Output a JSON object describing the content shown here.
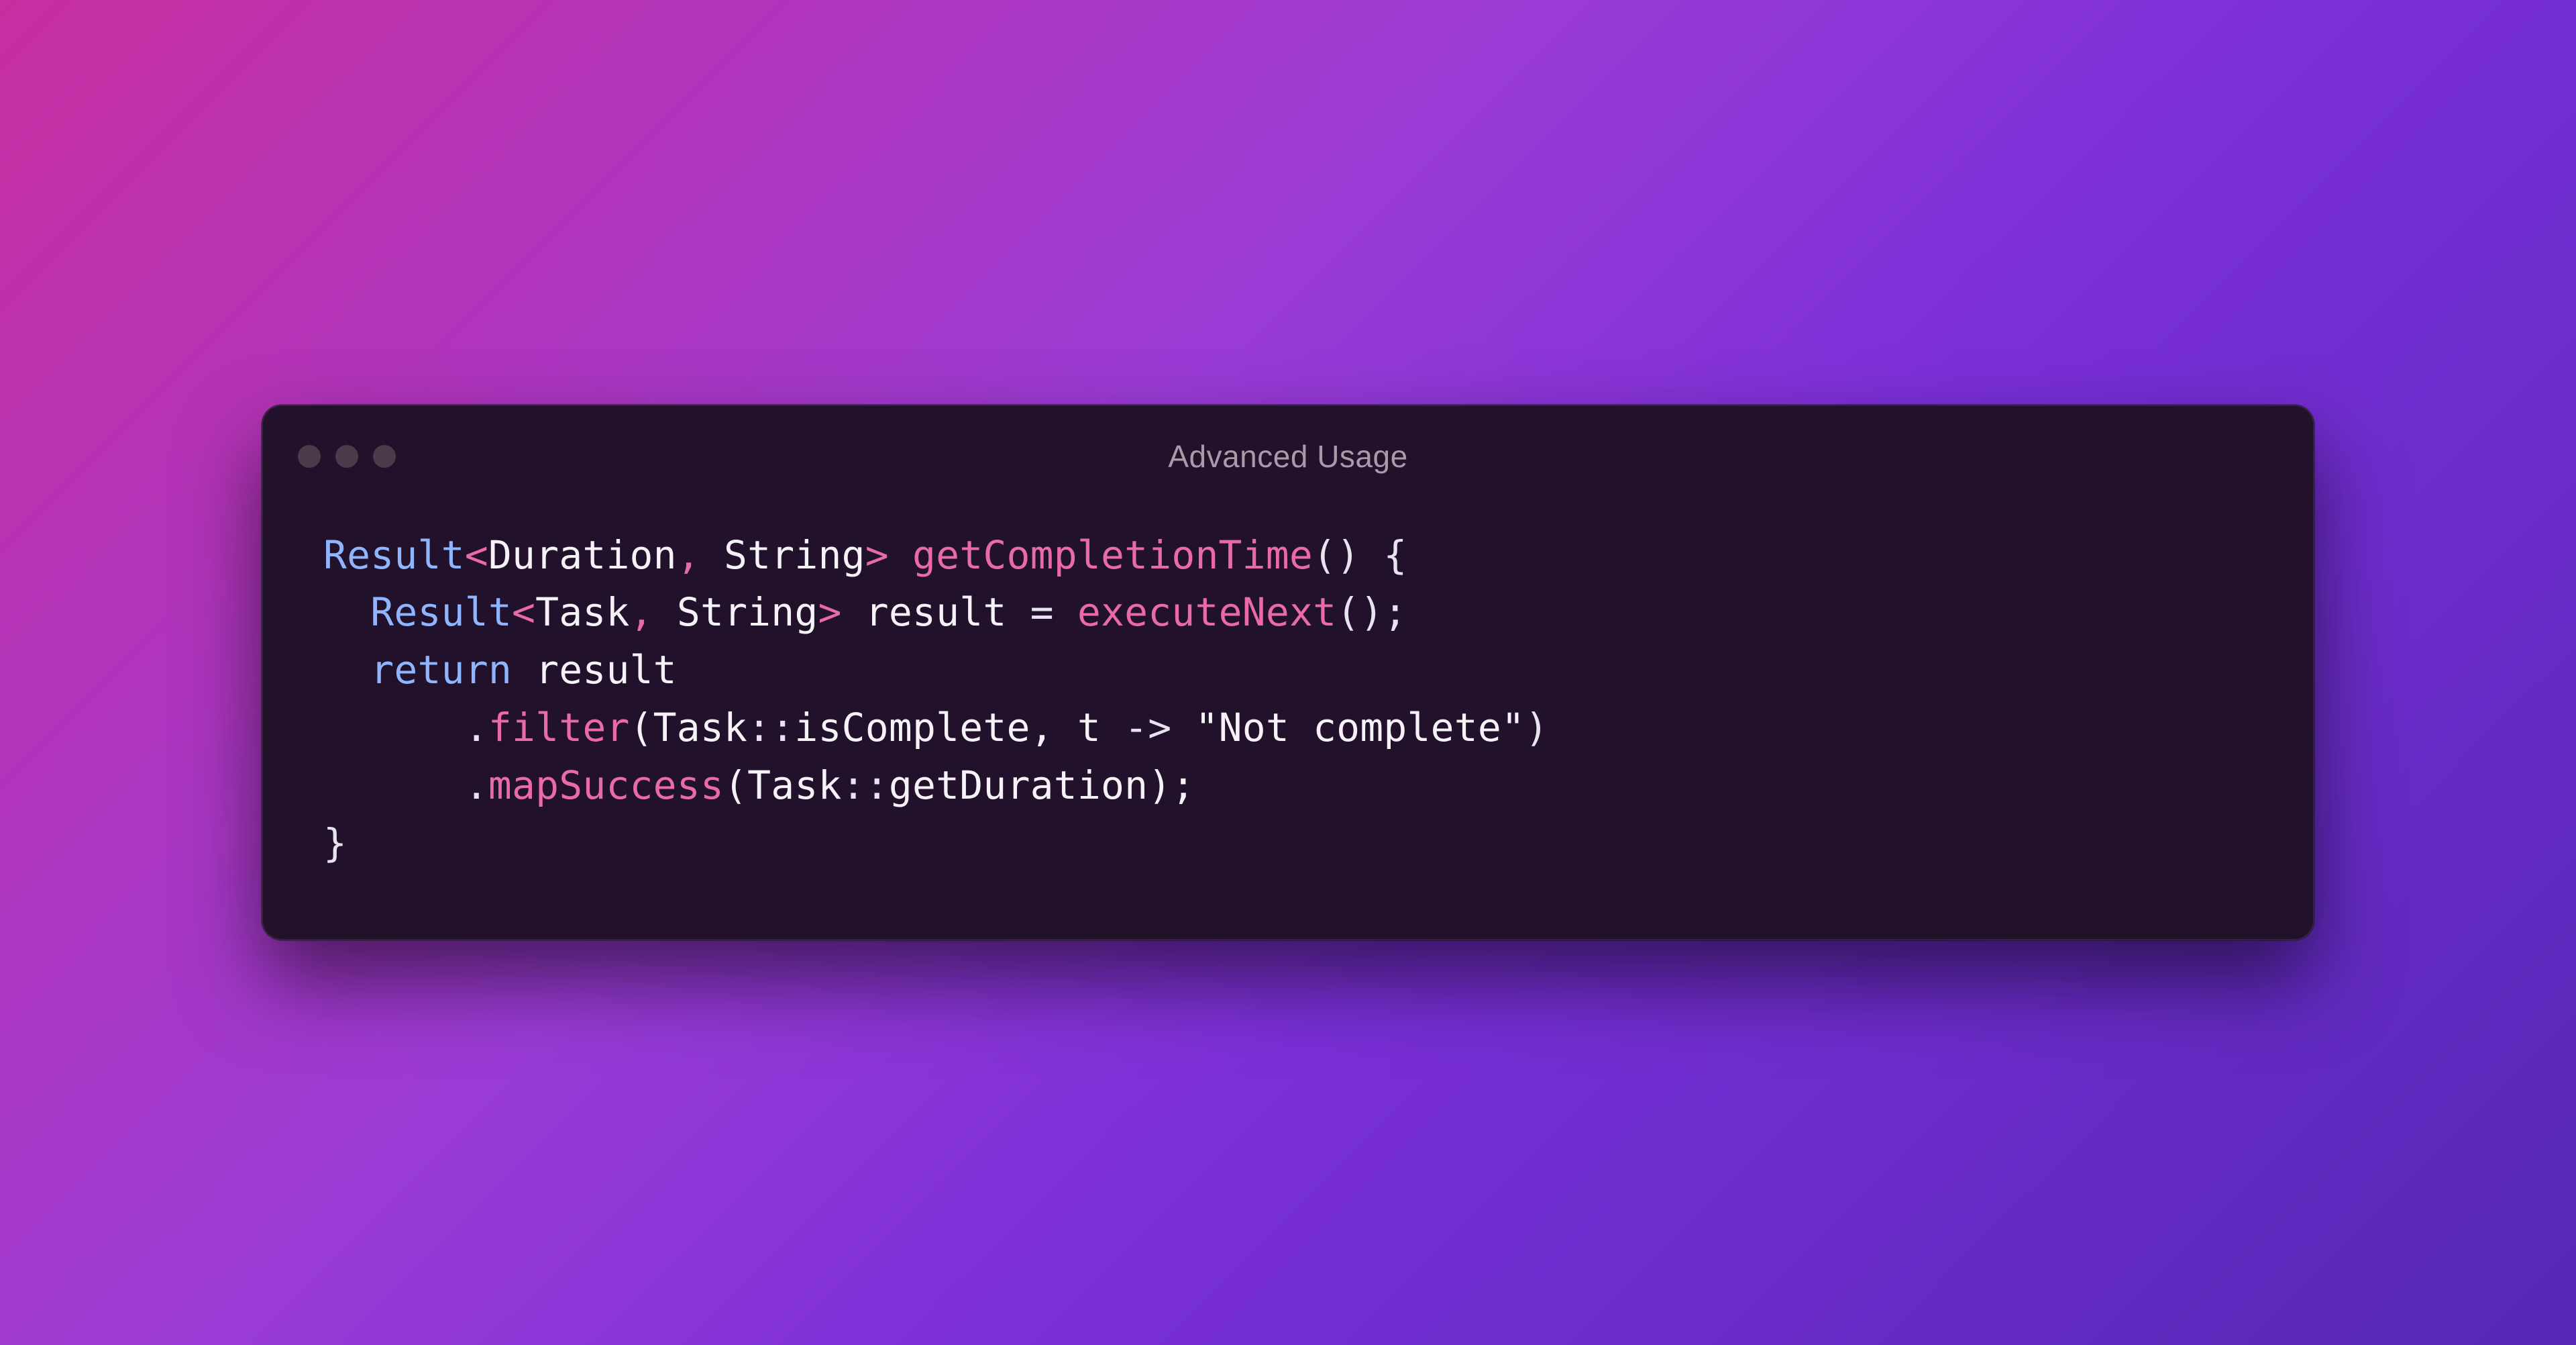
{
  "window": {
    "title": "Advanced Usage"
  },
  "code": {
    "l1": {
      "t1": "Result",
      "t2": "<",
      "t3": "Duration",
      "t4": ", ",
      "t5": "String",
      "t6": ">",
      "t7": " ",
      "t8": "getCompletionTime",
      "t9": "() {"
    },
    "l2": {
      "indent": "  ",
      "t1": "Result",
      "t2": "<",
      "t3": "Task",
      "t4": ", ",
      "t5": "String",
      "t6": ">",
      "t7": " result ",
      "t8": "=",
      "t9": " ",
      "t10": "executeNext",
      "t11": "();"
    },
    "l3": {
      "indent": "  ",
      "t1": "return",
      "t2": " result"
    },
    "l4": {
      "indent": "      ",
      "t1": ".",
      "t2": "filter",
      "t3": "(Task",
      "t4": "::",
      "t5": "isComplete, t ",
      "t6": "->",
      "t7": " ",
      "t8": "\"Not complete\"",
      "t9": ")"
    },
    "l5": {
      "indent": "      ",
      "t1": ".",
      "t2": "mapSuccess",
      "t3": "(Task",
      "t4": "::",
      "t5": "getDuration);"
    },
    "l6": {
      "t1": "}"
    }
  }
}
